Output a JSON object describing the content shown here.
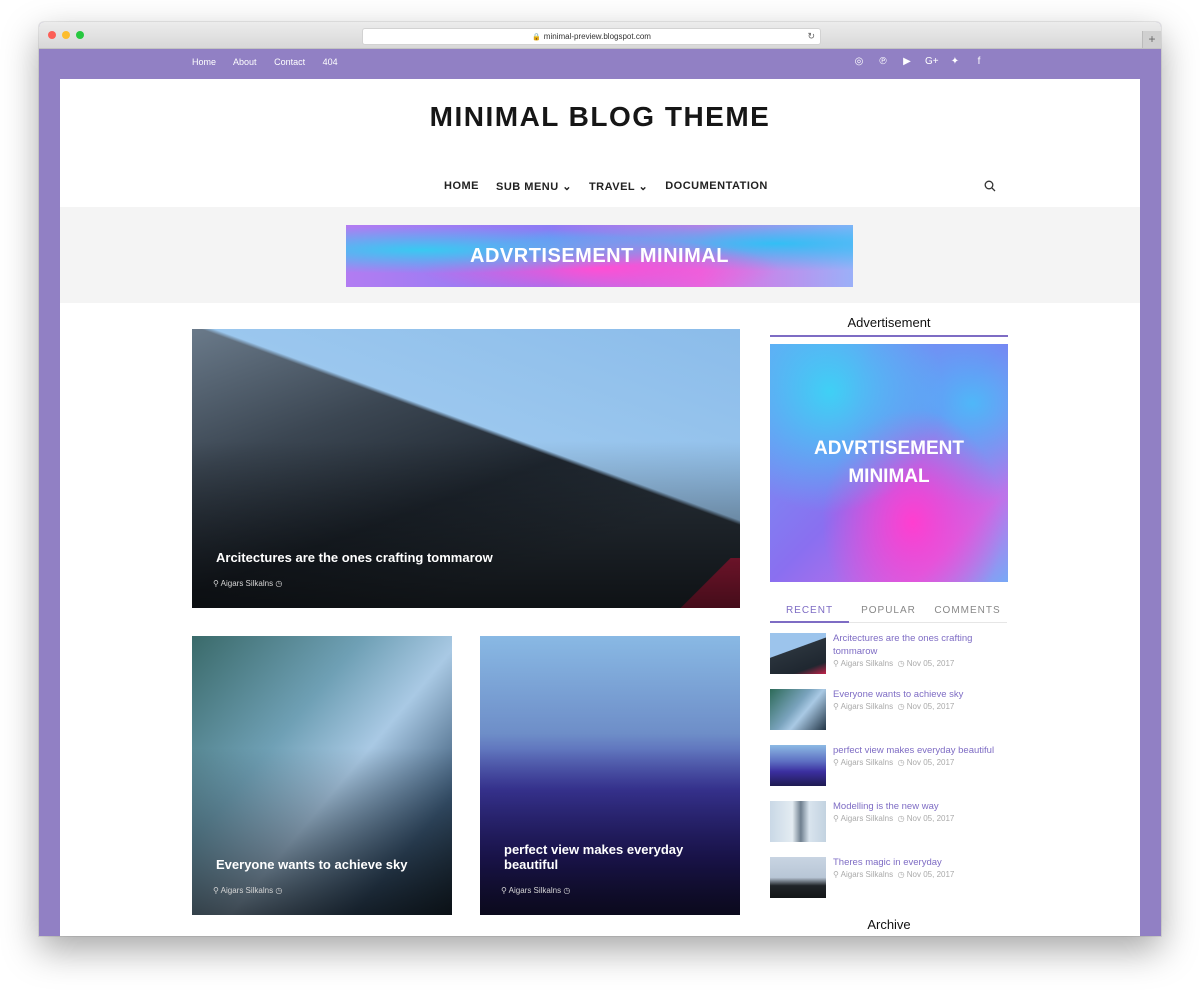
{
  "browser": {
    "url": "minimal-preview.blogspot.com",
    "new_tab": "+"
  },
  "topnav": [
    "Home",
    "About",
    "Contact",
    "404"
  ],
  "social": [
    "instagram-icon",
    "pinterest-icon",
    "youtube-icon",
    "google-plus-icon",
    "twitter-icon",
    "facebook-icon"
  ],
  "social_glyphs": [
    "◎",
    "℗",
    "▶",
    "G+",
    "✦",
    "f"
  ],
  "site": {
    "title": "MINIMAL BLOG THEME"
  },
  "mainnav": [
    "HOME",
    "SUB MENU",
    "TRAVEL",
    "DOCUMENTATION"
  ],
  "mainnav_chevrons": [
    "",
    "⌄",
    "⌄",
    ""
  ],
  "ad_banner": {
    "text": "ADVRTISEMENT MINIMAL"
  },
  "posts": [
    {
      "title": "Arcitectures are the ones crafting tommarow",
      "author": "Aigars Silkalns"
    },
    {
      "title": "Everyone wants to achieve sky",
      "author": "Aigars Silkalns"
    },
    {
      "title": "perfect view makes everyday beautiful",
      "author": "Aigars Silkalns"
    }
  ],
  "sidebar": {
    "ad_title": "Advertisement",
    "ad_line1": "ADVRTISEMENT",
    "ad_line2": "MINIMAL",
    "tabs": [
      "RECENT",
      "POPULAR",
      "COMMENTS"
    ],
    "recent": [
      {
        "title": "Arcitectures are the ones crafting tommarow",
        "author": "Aigars Silkalns",
        "date": "Nov 05, 2017"
      },
      {
        "title": "Everyone wants to achieve sky",
        "author": "Aigars Silkalns",
        "date": "Nov 05, 2017"
      },
      {
        "title": "perfect view makes everyday beautiful",
        "author": "Aigars Silkalns",
        "date": "Nov 05, 2017"
      },
      {
        "title": "Modelling is the new way",
        "author": "Aigars Silkalns",
        "date": "Nov 05, 2017"
      },
      {
        "title": "Theres magic in everyday",
        "author": "Aigars Silkalns",
        "date": "Nov 05, 2017"
      }
    ],
    "archive_title": "Archive"
  },
  "colors": {
    "frame": "#9180c4",
    "accent": "#7e6cc4"
  }
}
